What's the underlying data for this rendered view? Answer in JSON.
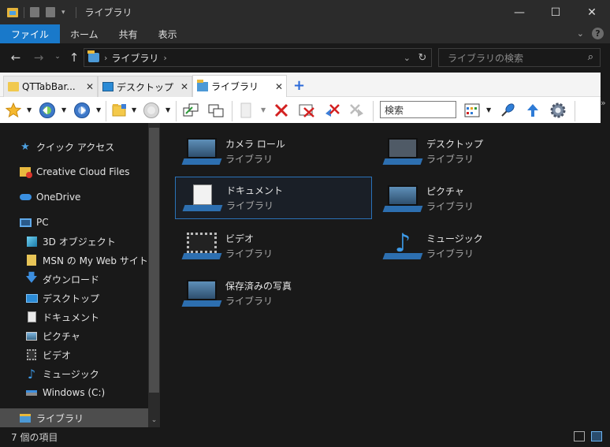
{
  "window": {
    "title": "ライブラリ",
    "controls": {
      "minimize": "—",
      "maximize": "☐",
      "close": "✕"
    }
  },
  "ribbon": {
    "tabs": [
      {
        "label": "ファイル",
        "active": true
      },
      {
        "label": "ホーム"
      },
      {
        "label": "共有"
      },
      {
        "label": "表示"
      }
    ],
    "help": "?"
  },
  "address": {
    "path": "ライブラリ",
    "search_placeholder": "ライブラリの検索"
  },
  "qttabbar": {
    "tabs": [
      {
        "label": "QTTabBar...",
        "icon": "folder-icon"
      },
      {
        "label": "デスクトップ",
        "icon": "desktop-icon"
      },
      {
        "label": "ライブラリ",
        "icon": "library-icon",
        "active": true
      }
    ],
    "new_tab": "+",
    "search_box": "検索"
  },
  "sidebar": {
    "items": [
      {
        "label": "クイック アクセス",
        "icon": "star-icon"
      },
      {
        "label": "Creative Cloud Files",
        "icon": "creative-cloud-icon"
      },
      {
        "label": "OneDrive",
        "icon": "onedrive-icon"
      },
      {
        "label": "PC",
        "icon": "pc-icon"
      },
      {
        "label": "3D オブジェクト",
        "icon": "3d-objects-icon"
      },
      {
        "label": "MSN の My Web サイト",
        "icon": "folder-icon"
      },
      {
        "label": "ダウンロード",
        "icon": "download-icon"
      },
      {
        "label": "デスクトップ",
        "icon": "desktop-icon"
      },
      {
        "label": "ドキュメント",
        "icon": "document-icon"
      },
      {
        "label": "ピクチャ",
        "icon": "picture-icon"
      },
      {
        "label": "ビデオ",
        "icon": "video-icon"
      },
      {
        "label": "ミュージック",
        "icon": "music-icon"
      },
      {
        "label": "Windows (C:)",
        "icon": "drive-icon"
      },
      {
        "label": "ライブラリ",
        "icon": "library-icon",
        "selected": true
      }
    ]
  },
  "libraries": {
    "items": [
      {
        "name": "カメラ ロール",
        "type": "ライブラリ"
      },
      {
        "name": "デスクトップ",
        "type": "ライブラリ"
      },
      {
        "name": "ドキュメント",
        "type": "ライブラリ",
        "focused": true
      },
      {
        "name": "ピクチャ",
        "type": "ライブラリ"
      },
      {
        "name": "ビデオ",
        "type": "ライブラリ"
      },
      {
        "name": "ミュージック",
        "type": "ライブラリ"
      },
      {
        "name": "保存済みの写真",
        "type": "ライブラリ"
      }
    ]
  },
  "status": {
    "item_count": "7 個の項目"
  },
  "colors": {
    "background": "#191919",
    "accent": "#1979ca",
    "selection": "#4d4d4d"
  }
}
